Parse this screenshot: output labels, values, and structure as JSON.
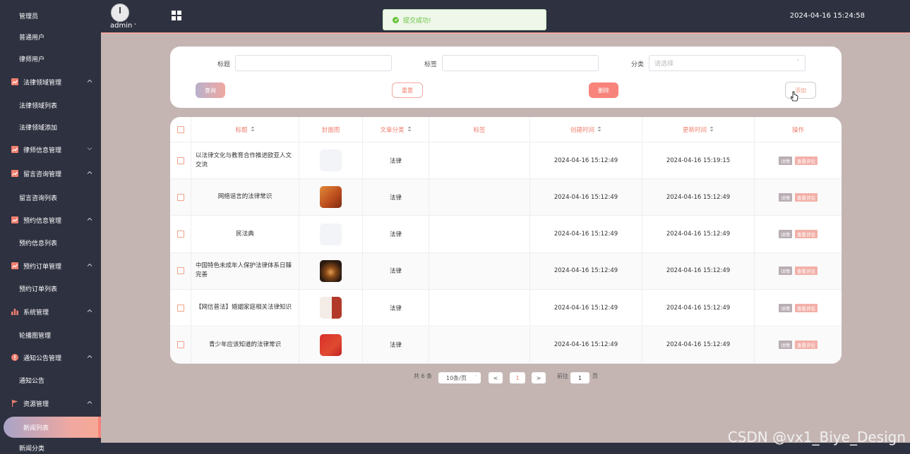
{
  "sidebar": {
    "items": [
      {
        "label": "管理员",
        "kind": "sub"
      },
      {
        "label": "普通用户",
        "kind": "sub"
      },
      {
        "label": "律师用户",
        "kind": "sub"
      },
      {
        "label": "法律领域管理",
        "kind": "group",
        "icon": "chart-icon",
        "expanded": true
      },
      {
        "label": "法律领域列表",
        "kind": "sub"
      },
      {
        "label": "法律领域添加",
        "kind": "sub"
      },
      {
        "label": "律师信息管理",
        "kind": "group",
        "icon": "chart-icon",
        "expanded": false
      },
      {
        "label": "留言咨询管理",
        "kind": "group",
        "icon": "chart-icon",
        "expanded": true
      },
      {
        "label": "留言咨询列表",
        "kind": "sub"
      },
      {
        "label": "预约信息管理",
        "kind": "group",
        "icon": "chart-icon",
        "expanded": true
      },
      {
        "label": "预约信息列表",
        "kind": "sub"
      },
      {
        "label": "预约订单管理",
        "kind": "group",
        "icon": "chart-icon",
        "expanded": true
      },
      {
        "label": "预约订单列表",
        "kind": "sub"
      },
      {
        "label": "系统管理",
        "kind": "group",
        "icon": "bar-chart-icon",
        "expanded": true
      },
      {
        "label": "轮播图管理",
        "kind": "sub"
      },
      {
        "label": "通知公告管理",
        "kind": "group",
        "icon": "alert-icon",
        "expanded": true
      },
      {
        "label": "通知公告",
        "kind": "sub"
      },
      {
        "label": "资源管理",
        "kind": "group",
        "icon": "flag-icon",
        "expanded": true
      },
      {
        "label": "新闻列表",
        "kind": "active"
      },
      {
        "label": "新闻分类",
        "kind": "sub"
      }
    ]
  },
  "header": {
    "user": "admin",
    "datetime": "2024-04-16 15:24:58",
    "toast": "提交成功!"
  },
  "search": {
    "title_label": "标题",
    "tag_label": "标签",
    "category_label": "分类",
    "category_placeholder": "请选择",
    "query_btn": "查询",
    "reset_btn": "重置",
    "delete_btn": "删除",
    "add_btn": "添加"
  },
  "table": {
    "columns": [
      {
        "label": "标题",
        "sortable": true
      },
      {
        "label": "封面图",
        "sortable": false
      },
      {
        "label": "文章分类",
        "sortable": true
      },
      {
        "label": "标签",
        "sortable": false
      },
      {
        "label": "创建时间",
        "sortable": true
      },
      {
        "label": "更新时间",
        "sortable": true
      },
      {
        "label": "操作",
        "sortable": false
      }
    ],
    "rows": [
      {
        "title": "以法律文化与教育合作推进欧亚人文交流",
        "cover": "blank",
        "category": "法律",
        "tag": "",
        "created": "2024-04-16 15:12:49",
        "updated": "2024-04-16 15:19:15"
      },
      {
        "title": "网络谣言的法律常识",
        "cover": "orange",
        "category": "法律",
        "tag": "",
        "created": "2024-04-16 15:12:49",
        "updated": "2024-04-16 15:12:49"
      },
      {
        "title": "民法典",
        "cover": "blank",
        "category": "法律",
        "tag": "",
        "created": "2024-04-16 15:12:49",
        "updated": "2024-04-16 15:12:49"
      },
      {
        "title": "中国特色未成年人保护法律体系日臻完善",
        "cover": "dark",
        "category": "法律",
        "tag": "",
        "created": "2024-04-16 15:12:49",
        "updated": "2024-04-16 15:12:49"
      },
      {
        "title": "【网信普法】婚姻家庭相关法律知识",
        "cover": "red-white",
        "category": "法律",
        "tag": "",
        "created": "2024-04-16 15:12:49",
        "updated": "2024-04-16 15:12:49"
      },
      {
        "title": "青少年应该知道的法律常识",
        "cover": "red",
        "category": "法律",
        "tag": "",
        "created": "2024-04-16 15:12:49",
        "updated": "2024-04-16 15:12:49"
      }
    ],
    "action_detail": "详情",
    "action_comments": "查看评论"
  },
  "pagination": {
    "total": "共 6 条",
    "page_size": "10条/页",
    "prev": "<",
    "current": "1",
    "next": ">",
    "goto_prefix": "前往",
    "goto_value": "1",
    "goto_suffix": "页"
  },
  "watermark": "CSDN @vx1_Biye_Design",
  "colors": {
    "sidebar_bg": "#2e3140",
    "content_bg": "#c4b5b3",
    "accent": "#f08070",
    "success": "#67c23a"
  }
}
